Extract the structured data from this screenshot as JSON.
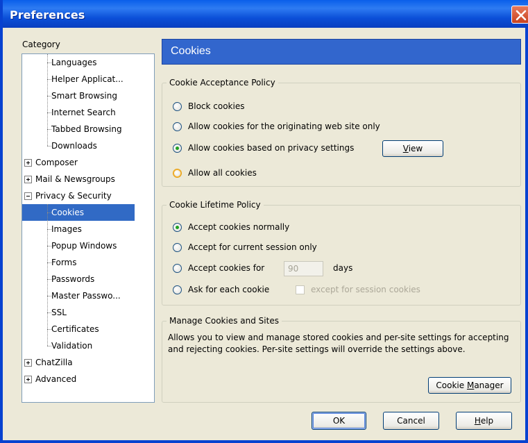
{
  "window": {
    "title": "Preferences"
  },
  "category": {
    "label": "Category",
    "items": [
      {
        "label": "Languages",
        "kind": "child"
      },
      {
        "label": "Helper Applicat...",
        "kind": "child"
      },
      {
        "label": "Smart Browsing",
        "kind": "child"
      },
      {
        "label": "Internet Search",
        "kind": "child"
      },
      {
        "label": "Tabbed Browsing",
        "kind": "child"
      },
      {
        "label": "Downloads",
        "kind": "child"
      },
      {
        "label": "Composer",
        "kind": "parent",
        "expander": "plus"
      },
      {
        "label": "Mail & Newsgroups",
        "kind": "parent",
        "expander": "plus"
      },
      {
        "label": "Privacy & Security",
        "kind": "parent",
        "expander": "minus"
      },
      {
        "label": "Cookies",
        "kind": "child",
        "selected": true
      },
      {
        "label": "Images",
        "kind": "child"
      },
      {
        "label": "Popup Windows",
        "kind": "child"
      },
      {
        "label": "Forms",
        "kind": "child"
      },
      {
        "label": "Passwords",
        "kind": "child"
      },
      {
        "label": "Master Passwo...",
        "kind": "child"
      },
      {
        "label": "SSL",
        "kind": "child"
      },
      {
        "label": "Certificates",
        "kind": "child"
      },
      {
        "label": "Validation",
        "kind": "child"
      },
      {
        "label": "ChatZilla",
        "kind": "parent",
        "expander": "plus"
      },
      {
        "label": "Advanced",
        "kind": "parent",
        "expander": "plus"
      }
    ]
  },
  "panel": {
    "header": "Cookies",
    "acceptance": {
      "title": "Cookie Acceptance Policy",
      "options": [
        {
          "label": "Block cookies",
          "checked": false
        },
        {
          "label": "Allow cookies for the originating web site only",
          "checked": false
        },
        {
          "label": "Allow cookies based on privacy settings",
          "checked": true
        },
        {
          "label": "Allow all cookies",
          "checked": false
        }
      ],
      "view_button_pre": "",
      "view_button_ul": "V",
      "view_button_post": "iew"
    },
    "lifetime": {
      "title": "Cookie Lifetime Policy",
      "options": [
        {
          "label": "Accept cookies normally",
          "checked": true
        },
        {
          "label": "Accept for current session only",
          "checked": false
        },
        {
          "label": "Accept cookies for",
          "checked": false
        },
        {
          "label": "Ask for each cookie",
          "checked": false
        }
      ],
      "days_value": "90",
      "days_label": "days",
      "except_label": "except for session cookies"
    },
    "manage": {
      "title": "Manage Cookies and Sites",
      "description": "Allows you to view and manage stored cookies and per-site settings for accepting and rejecting cookies. Per-site settings will override the settings above.",
      "button_pre": "Cookie ",
      "button_ul": "M",
      "button_post": "anager"
    }
  },
  "footer": {
    "ok": "OK",
    "cancel": "Cancel",
    "help_ul": "H",
    "help_post": "elp"
  },
  "colors": {
    "titlebar": "#0a5fea",
    "header": "#3266cd",
    "selection": "#316ac5",
    "dialog": "#ece9d8"
  }
}
